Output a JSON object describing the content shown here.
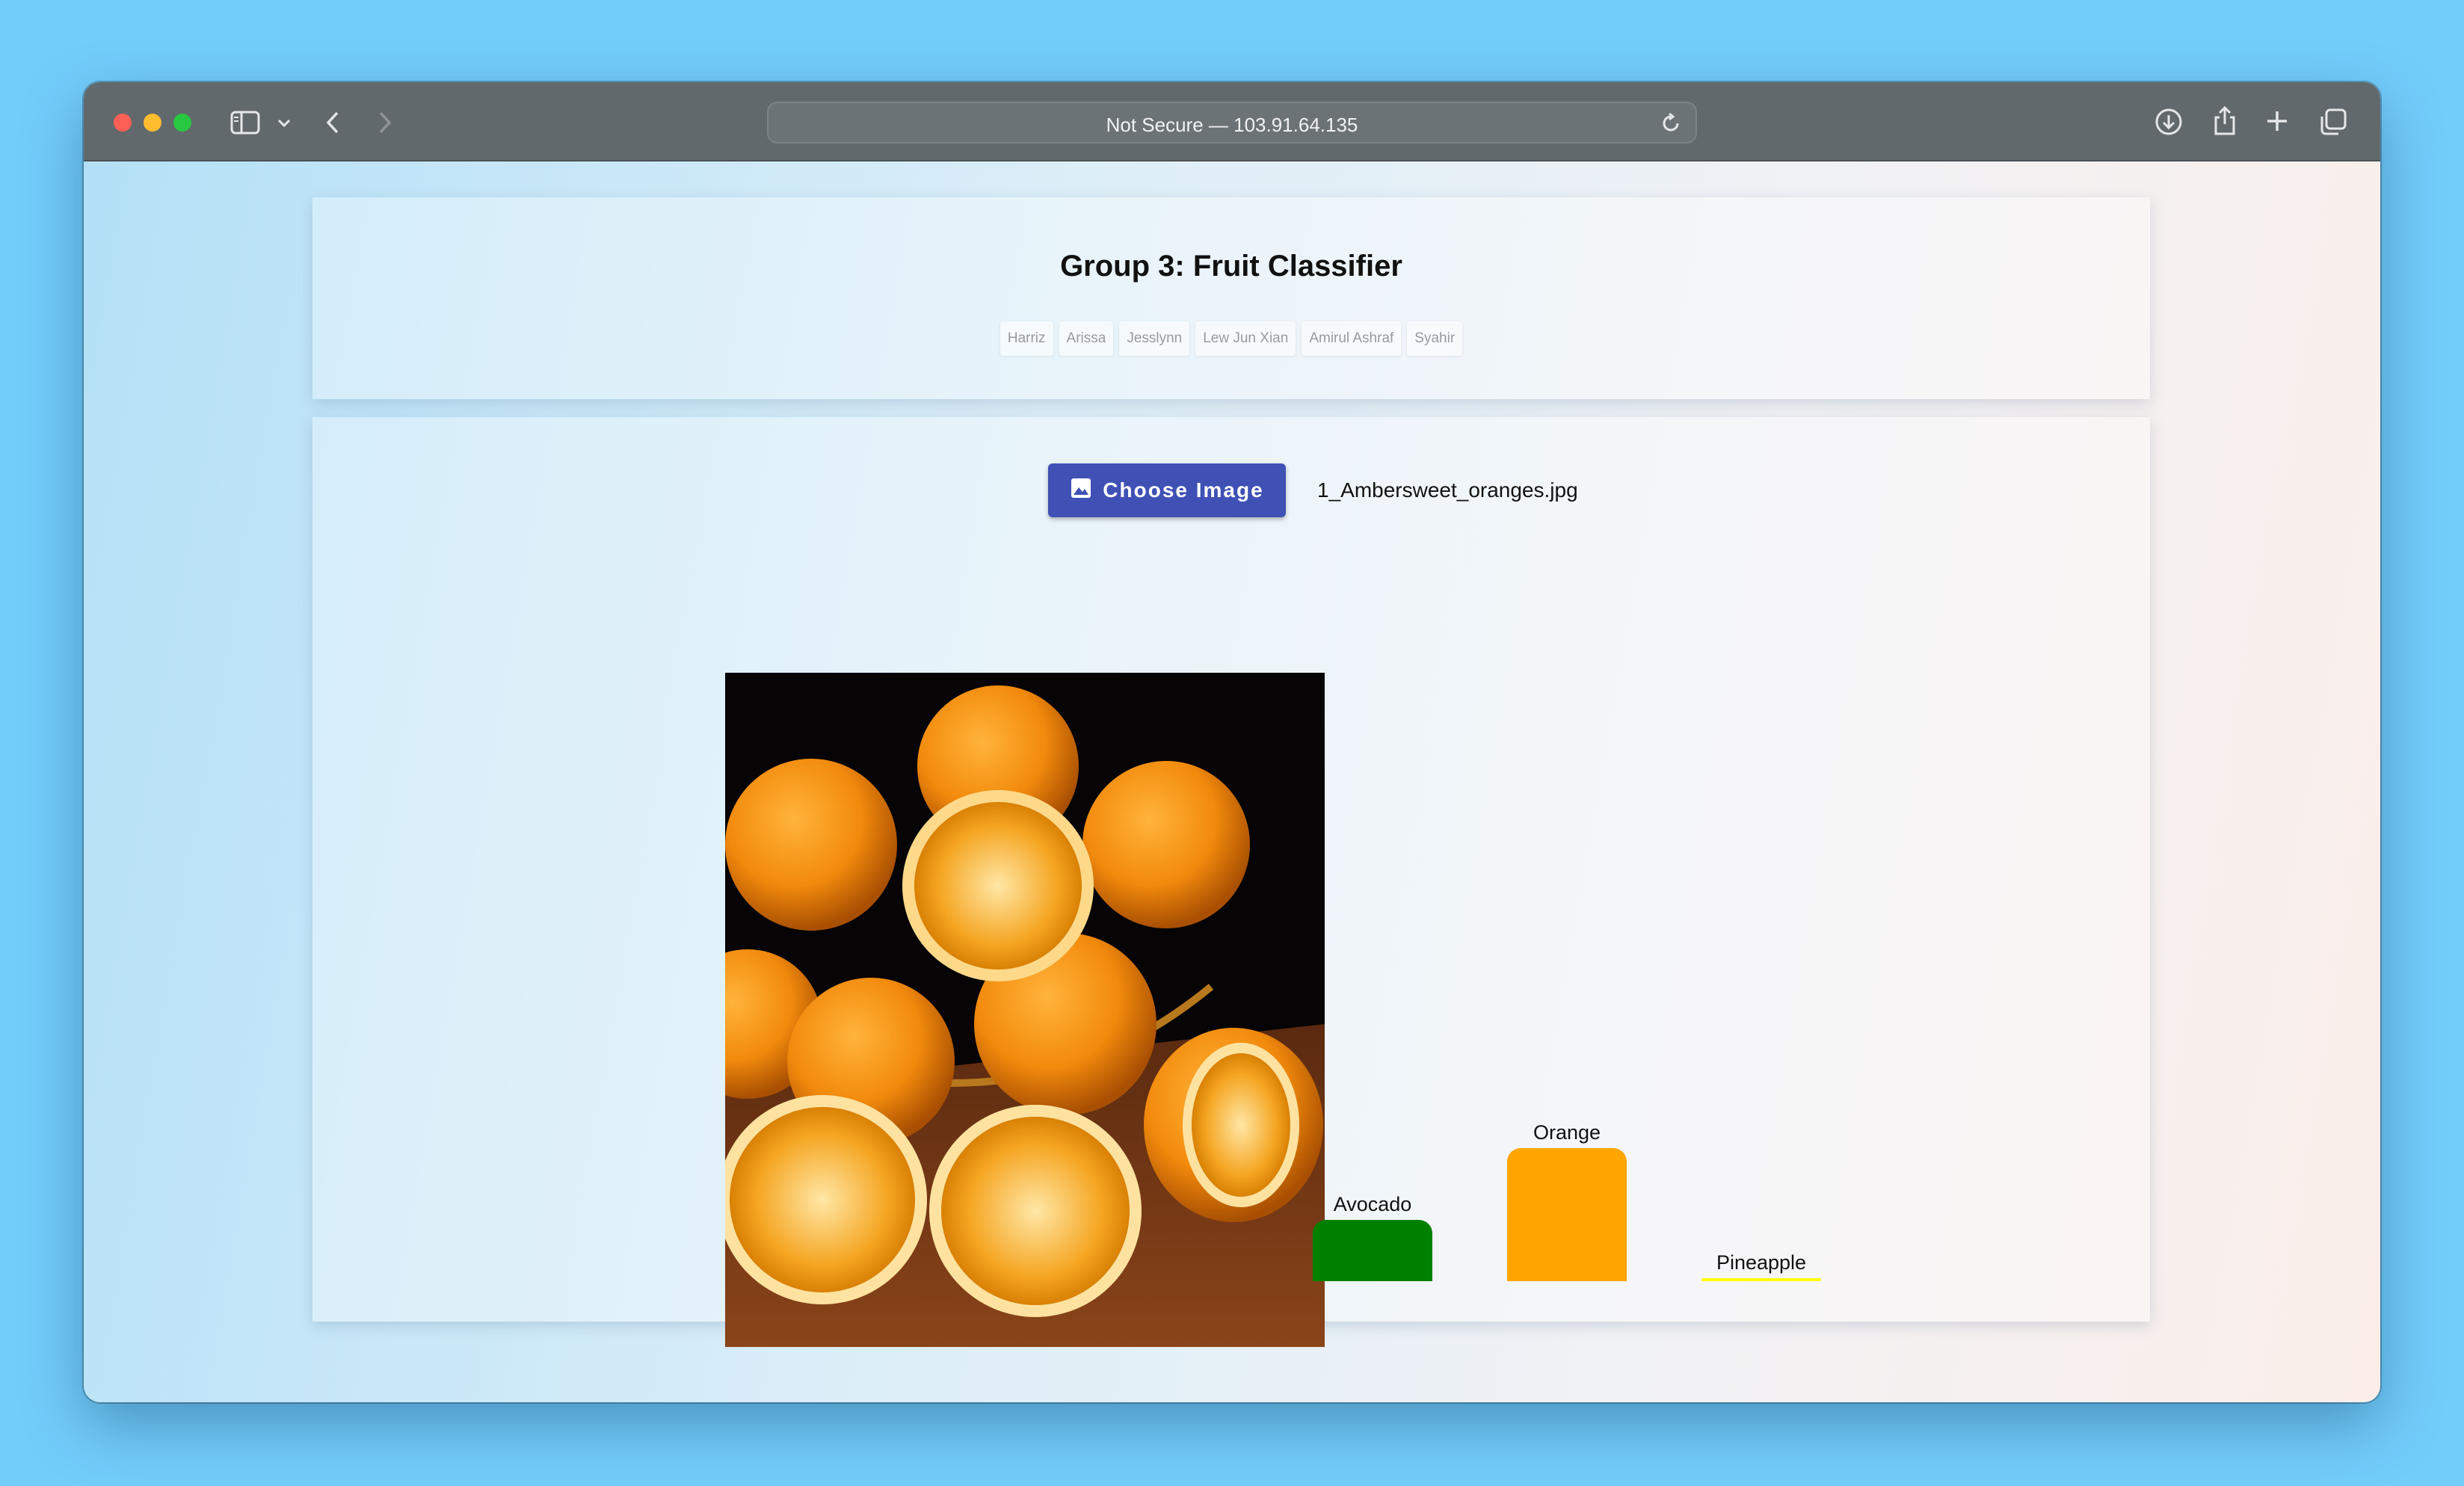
{
  "browser": {
    "url_text": "Not Secure — 103.91.64.135"
  },
  "header": {
    "title": "Group 3: Fruit Classifier",
    "members": [
      "Harriz",
      "Arissa",
      "Jesslynn",
      "Lew Jun Xian",
      "Amirul Ashraf",
      "Syahir"
    ]
  },
  "upload": {
    "button_label": "Choose Image",
    "file_name": "1_Ambersweet_oranges.jpg"
  },
  "colors": {
    "button": "#3f51b5",
    "avocado": "#008000",
    "orange": "#ffa500",
    "pineapple": "#ffff00"
  },
  "chart_data": {
    "type": "bar",
    "categories": [
      "Avocado",
      "Orange",
      "Pineapple"
    ],
    "values": [
      0.46,
      1.0,
      0.02
    ],
    "colors": [
      "#008000",
      "#ffa500",
      "#ffff00"
    ],
    "title": "",
    "xlabel": "",
    "ylabel": ""
  }
}
